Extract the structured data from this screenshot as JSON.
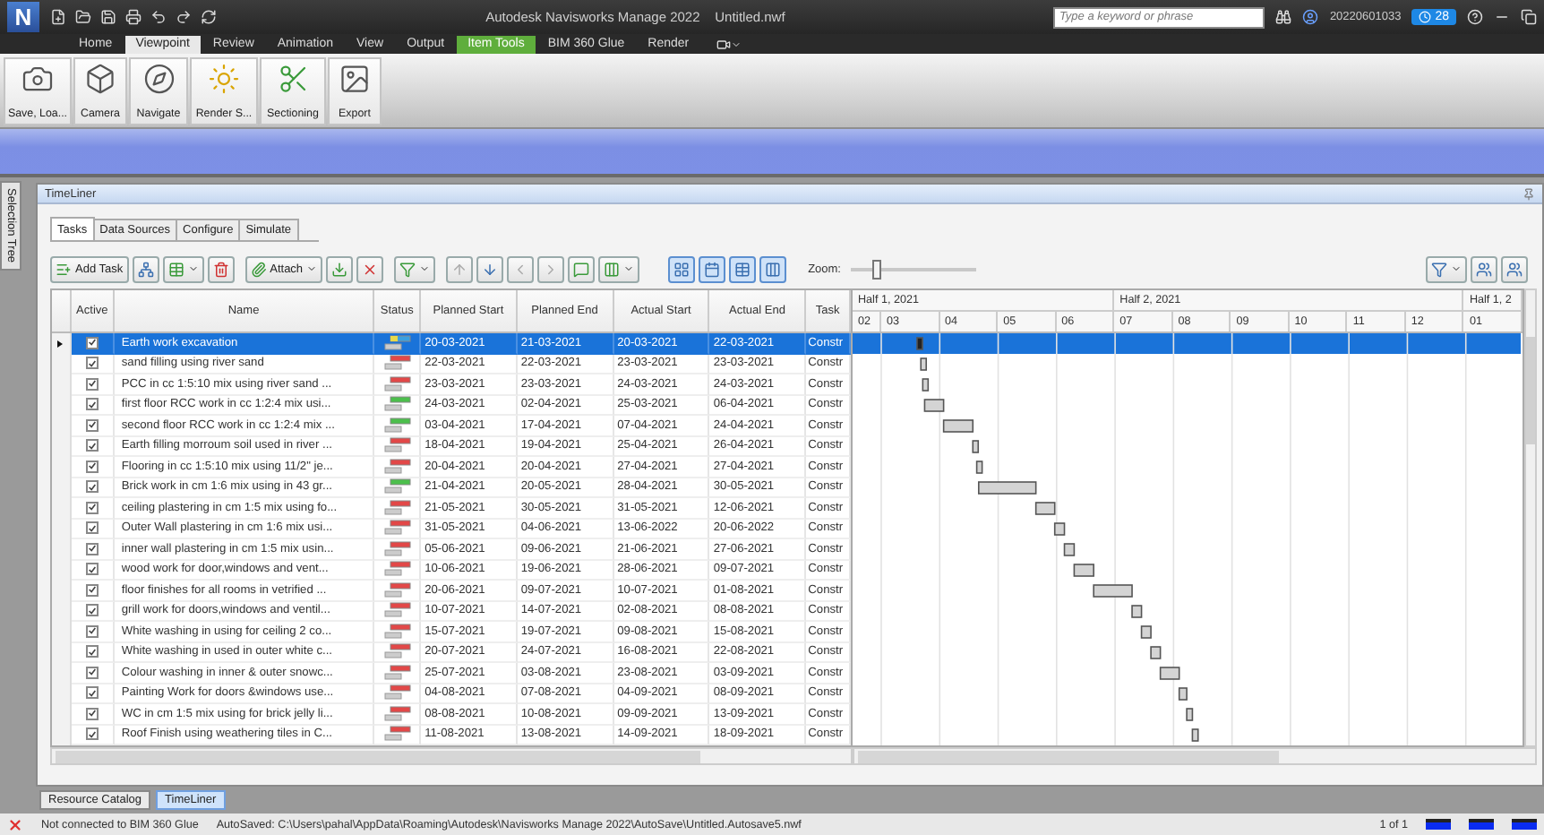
{
  "window": {
    "logo": "N",
    "title": "Autodesk Navisworks Manage 2022    Untitled.nwf",
    "search_placeholder": "Type a keyword or phrase",
    "user": "20220601033",
    "notifications": "28"
  },
  "ribbon": {
    "tabs": [
      {
        "label": "Home",
        "selected": false,
        "kind": "normal"
      },
      {
        "label": "Viewpoint",
        "selected": true,
        "kind": "normal"
      },
      {
        "label": "Review",
        "selected": false,
        "kind": "normal"
      },
      {
        "label": "Animation",
        "selected": false,
        "kind": "normal"
      },
      {
        "label": "View",
        "selected": false,
        "kind": "normal"
      },
      {
        "label": "Output",
        "selected": false,
        "kind": "normal"
      },
      {
        "label": "Item Tools",
        "selected": false,
        "kind": "contextual"
      },
      {
        "label": "BIM 360 Glue",
        "selected": false,
        "kind": "normal"
      },
      {
        "label": "Render",
        "selected": false,
        "kind": "normal"
      }
    ],
    "buttons": [
      "Save, Loa...",
      "Camera",
      "Navigate",
      "Render S...",
      "Sectioning",
      "Export"
    ]
  },
  "side_panel": {
    "label": "Selection Tree"
  },
  "timeliner": {
    "title": "TimeLiner",
    "tabs": [
      {
        "label": "Tasks",
        "selected": true
      },
      {
        "label": "Data Sources",
        "selected": false
      },
      {
        "label": "Configure",
        "selected": false
      },
      {
        "label": "Simulate",
        "selected": false
      }
    ],
    "toolbar": {
      "add_task": "Add Task",
      "attach": "Attach",
      "zoom_label": "Zoom:",
      "zoom": {
        "level": 0.2
      }
    },
    "table": {
      "columns": [
        "Active",
        "Name",
        "Status",
        "Planned Start",
        "Planned End",
        "Actual Start",
        "Actual End",
        "Task"
      ],
      "rows": [
        {
          "selected": true,
          "active": true,
          "name": "Earth work excavation",
          "kind": "on_time",
          "planned_start": "20-03-2021",
          "planned_end": "21-03-2021",
          "actual_start": "20-03-2021",
          "actual_end": "22-03-2021",
          "task": "Constr"
        },
        {
          "selected": false,
          "active": true,
          "name": "sand filling using river sand",
          "kind": "late",
          "planned_start": "22-03-2021",
          "planned_end": "22-03-2021",
          "actual_start": "23-03-2021",
          "actual_end": "23-03-2021",
          "task": "Constr"
        },
        {
          "selected": false,
          "active": true,
          "name": "PCC in cc 1:5:10 mix using river sand ...",
          "kind": "late",
          "planned_start": "23-03-2021",
          "planned_end": "23-03-2021",
          "actual_start": "24-03-2021",
          "actual_end": "24-03-2021",
          "task": "Constr"
        },
        {
          "selected": false,
          "active": true,
          "name": "first floor RCC work in cc 1:2:4 mix usi...",
          "kind": "early",
          "planned_start": "24-03-2021",
          "planned_end": "02-04-2021",
          "actual_start": "25-03-2021",
          "actual_end": "06-04-2021",
          "task": "Constr"
        },
        {
          "selected": false,
          "active": true,
          "name": "second floor RCC work in cc 1:2:4 mix ...",
          "kind": "early",
          "planned_start": "03-04-2021",
          "planned_end": "17-04-2021",
          "actual_start": "07-04-2021",
          "actual_end": "24-04-2021",
          "task": "Constr"
        },
        {
          "selected": false,
          "active": true,
          "name": "Earth filling morroum soil used in river ...",
          "kind": "late",
          "planned_start": "18-04-2021",
          "planned_end": "19-04-2021",
          "actual_start": "25-04-2021",
          "actual_end": "26-04-2021",
          "task": "Constr"
        },
        {
          "selected": false,
          "active": true,
          "name": "Flooring in cc 1:5:10 mix using 11/2\" je...",
          "kind": "late",
          "planned_start": "20-04-2021",
          "planned_end": "20-04-2021",
          "actual_start": "27-04-2021",
          "actual_end": "27-04-2021",
          "task": "Constr"
        },
        {
          "selected": false,
          "active": true,
          "name": "Brick work in cm 1:6 mix using in 43 gr...",
          "kind": "early",
          "planned_start": "21-04-2021",
          "planned_end": "20-05-2021",
          "actual_start": "28-04-2021",
          "actual_end": "30-05-2021",
          "task": "Constr"
        },
        {
          "selected": false,
          "active": true,
          "name": "ceiling plastering in cm 1:5 mix using fo...",
          "kind": "late",
          "planned_start": "21-05-2021",
          "planned_end": "30-05-2021",
          "actual_start": "31-05-2021",
          "actual_end": "12-06-2021",
          "task": "Constr"
        },
        {
          "selected": false,
          "active": true,
          "name": "Outer Wall plastering in cm 1:6 mix usi...",
          "kind": "late",
          "planned_start": "31-05-2021",
          "planned_end": "04-06-2021",
          "actual_start": "13-06-2022",
          "actual_end": "20-06-2022",
          "task": "Constr"
        },
        {
          "selected": false,
          "active": true,
          "name": "inner wall plastering in cm 1:5 mix usin...",
          "kind": "late",
          "planned_start": "05-06-2021",
          "planned_end": "09-06-2021",
          "actual_start": "21-06-2021",
          "actual_end": "27-06-2021",
          "task": "Constr"
        },
        {
          "selected": false,
          "active": true,
          "name": "wood work for door,windows and vent...",
          "kind": "late",
          "planned_start": "10-06-2021",
          "planned_end": "19-06-2021",
          "actual_start": "28-06-2021",
          "actual_end": "09-07-2021",
          "task": "Constr"
        },
        {
          "selected": false,
          "active": true,
          "name": "floor finishes for all rooms in vetrified ...",
          "kind": "late",
          "planned_start": "20-06-2021",
          "planned_end": "09-07-2021",
          "actual_start": "10-07-2021",
          "actual_end": "01-08-2021",
          "task": "Constr"
        },
        {
          "selected": false,
          "active": true,
          "name": "grill work for doors,windows and ventil...",
          "kind": "late",
          "planned_start": "10-07-2021",
          "planned_end": "14-07-2021",
          "actual_start": "02-08-2021",
          "actual_end": "08-08-2021",
          "task": "Constr"
        },
        {
          "selected": false,
          "active": true,
          "name": "White washing in using for ceiling 2 co...",
          "kind": "late",
          "planned_start": "15-07-2021",
          "planned_end": "19-07-2021",
          "actual_start": "09-08-2021",
          "actual_end": "15-08-2021",
          "task": "Constr"
        },
        {
          "selected": false,
          "active": true,
          "name": "White washing in used in outer white c...",
          "kind": "late",
          "planned_start": "20-07-2021",
          "planned_end": "24-07-2021",
          "actual_start": "16-08-2021",
          "actual_end": "22-08-2021",
          "task": "Constr"
        },
        {
          "selected": false,
          "active": true,
          "name": "Colour washing in inner & outer snowc...",
          "kind": "late",
          "planned_start": "25-07-2021",
          "planned_end": "03-08-2021",
          "actual_start": "23-08-2021",
          "actual_end": "03-09-2021",
          "task": "Constr"
        },
        {
          "selected": false,
          "active": true,
          "name": "Painting Work for doors &windows use...",
          "kind": "late",
          "planned_start": "04-08-2021",
          "planned_end": "07-08-2021",
          "actual_start": "04-09-2021",
          "actual_end": "08-09-2021",
          "task": "Constr"
        },
        {
          "selected": false,
          "active": true,
          "name": "WC in cm 1:5 mix using for brick jelly li...",
          "kind": "late",
          "planned_start": "08-08-2021",
          "planned_end": "10-08-2021",
          "actual_start": "09-09-2021",
          "actual_end": "13-09-2021",
          "task": "Constr"
        },
        {
          "selected": false,
          "active": true,
          "name": "Roof Finish using weathering tiles in C...",
          "kind": "late",
          "planned_start": "11-08-2021",
          "planned_end": "13-08-2021",
          "actual_start": "14-09-2021",
          "actual_end": "18-09-2021",
          "task": "Constr"
        }
      ]
    },
    "gantt": {
      "halves": [
        "Half 1, 2021",
        "Half 2, 2021",
        "Half 1, 2"
      ],
      "months": [
        "02",
        "03",
        "04",
        "05",
        "06",
        "07",
        "08",
        "09",
        "10",
        "11",
        "12",
        "01"
      ]
    }
  },
  "bottom_tabs": [
    {
      "label": "Resource Catalog",
      "selected": false
    },
    {
      "label": "TimeLiner",
      "selected": true
    }
  ],
  "status_bar": {
    "connection": "Not connected to BIM 360 Glue",
    "autosave": "AutoSaved: C:\\Users\\pahal\\AppData\\Roaming\\Autodesk\\Navisworks Manage 2022\\AutoSave\\Untitled.Autosave5.nwf",
    "page": "1 of 1"
  }
}
